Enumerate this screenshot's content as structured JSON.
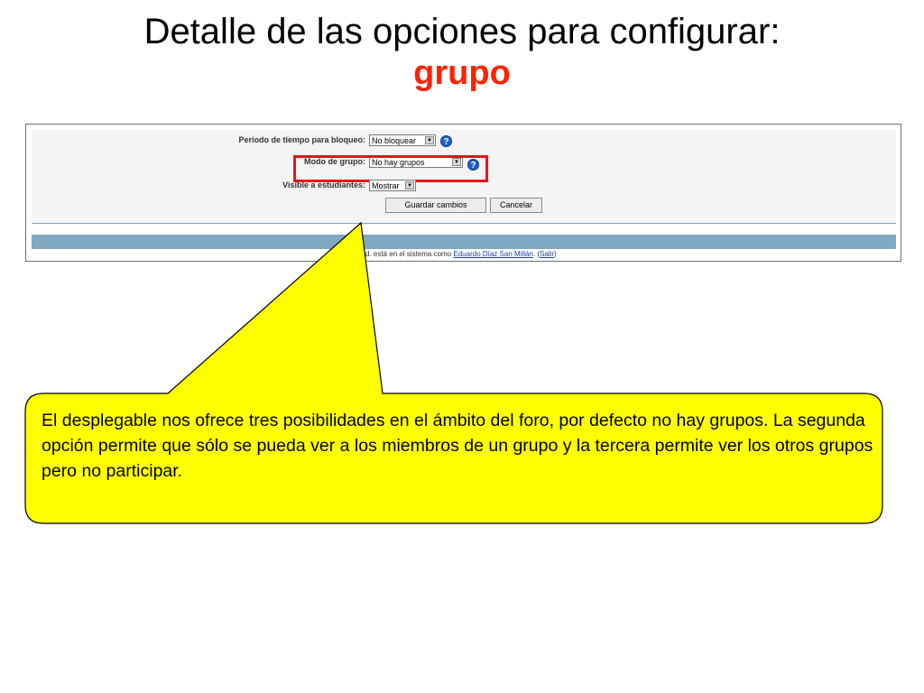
{
  "slide": {
    "title_line1": "Detalle de las opciones para configurar:",
    "title_line2": "grupo"
  },
  "form": {
    "block_period_label": "Período de tiempo para bloqueo:",
    "block_period_value": "No bloquear",
    "group_mode_label": "Modo de grupo:",
    "group_mode_value": "No hay grupos",
    "visible_label": "Visible a estudiantes:",
    "visible_value": "Mostrar",
    "save_button": "Guardar cambios",
    "cancel_button": "Cancelar"
  },
  "footer": {
    "text_prefix": "d. está en el sistema como ",
    "user_link": "Eduardo Díaz San Millán",
    "separator": ". (",
    "logout_link": "Salir",
    "close": ")"
  },
  "callout": {
    "text": "El desplegable nos ofrece tres posibilidades en el ámbito del foro, por defecto no hay grupos. La segunda opción permite que sólo se pueda ver a los miembros de un grupo y la tercera permite ver los otros grupos pero no participar."
  },
  "colors": {
    "title_accent": "#ff2200",
    "highlight_border": "#e8141b",
    "callout_fill": "#ffff00",
    "bar": "#7fa9c3"
  },
  "icons": {
    "help": "help-question-icon",
    "dropdown": "chevron-down-icon"
  }
}
